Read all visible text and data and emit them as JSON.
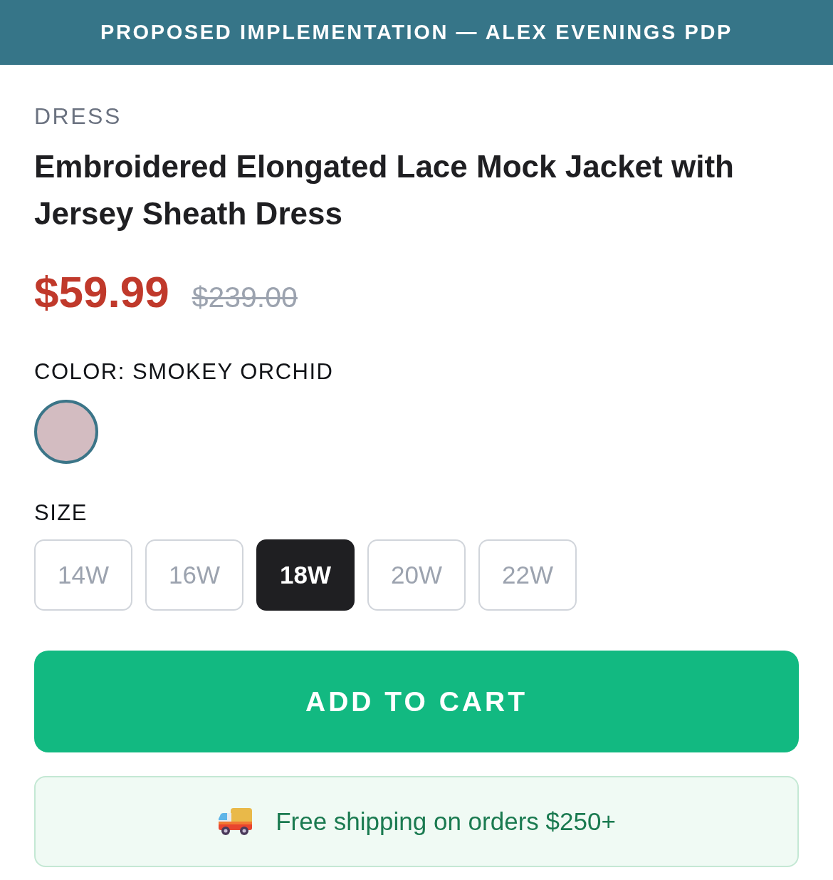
{
  "banner": {
    "title": "PROPOSED IMPLEMENTATION — ALEX EVENINGS PDP"
  },
  "product": {
    "category": "DRESS",
    "title": "Embroidered Elongated Lace Mock Jacket with Jersey Sheath Dress",
    "price": "$59.99",
    "original_price": "$239.00"
  },
  "color": {
    "label": "COLOR: SMOKEY ORCHID",
    "swatches": [
      {
        "color": "#d3bcc1",
        "selected": true
      }
    ]
  },
  "size": {
    "label": "SIZE",
    "options": [
      {
        "label": "14W",
        "selected": false
      },
      {
        "label": "16W",
        "selected": false
      },
      {
        "label": "18W",
        "selected": true
      },
      {
        "label": "20W",
        "selected": false
      },
      {
        "label": "22W",
        "selected": false
      }
    ]
  },
  "add_to_cart": {
    "label": "ADD TO CART"
  },
  "shipping": {
    "text": "Free shipping on orders $250+"
  }
}
